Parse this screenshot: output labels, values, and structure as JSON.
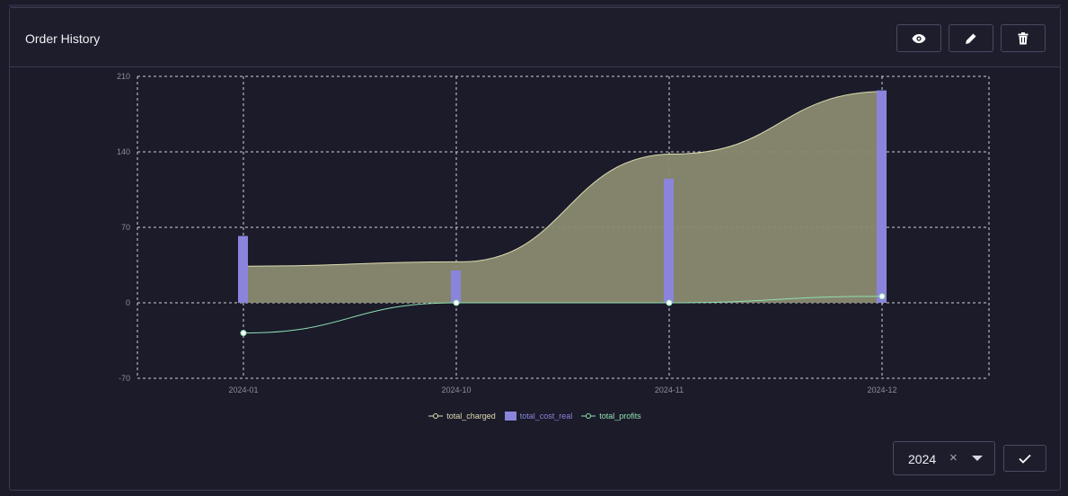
{
  "header": {
    "title": "Order History",
    "actions": [
      {
        "name": "view",
        "icon": "eye-icon"
      },
      {
        "name": "edit",
        "icon": "pencil-icon"
      },
      {
        "name": "delete",
        "icon": "trash-icon"
      }
    ]
  },
  "chart_data": {
    "type": "bar",
    "categories": [
      "2024-01",
      "2024-10",
      "2024-11",
      "2024-12"
    ],
    "ylim": [
      -70,
      210
    ],
    "yticks": [
      -70,
      0,
      70,
      140,
      210
    ],
    "grid": true,
    "legend_position": "bottom",
    "series": [
      {
        "name": "total_charged",
        "type": "area",
        "color": "#dcdcb0",
        "values": [
          34,
          38,
          138,
          196
        ]
      },
      {
        "name": "total_cost_real",
        "type": "bar",
        "color": "#8b84dc",
        "values": [
          62,
          30,
          115,
          197
        ]
      },
      {
        "name": "total_profits",
        "type": "line",
        "color": "#8fe0b0",
        "values": [
          -28,
          0,
          0,
          6
        ]
      }
    ]
  },
  "filter": {
    "year": "2024",
    "clear_symbol": "×"
  },
  "colors": {
    "background": "#1b1b2a",
    "grid": "#d0d0d8",
    "area_fill": "#8a8a70"
  }
}
